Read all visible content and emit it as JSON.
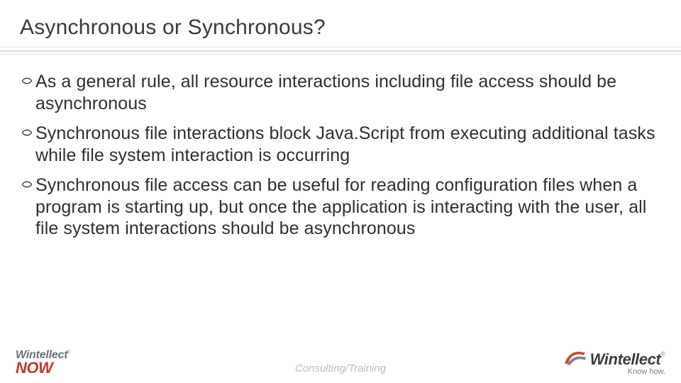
{
  "title": "Asynchronous or Synchronous?",
  "bullets": [
    "As a general rule, all resource interactions including file access should be asynchronous",
    "Synchronous file interactions block Java.Script from executing additional tasks while file system interaction is occurring",
    "Synchronous file access can be useful for reading configuration files when a program is starting up, but once the application is interacting with the user, all file system interactions should be asynchronous"
  ],
  "footer_tag": "Consulting/Training",
  "logo_left": {
    "brand": "Wintellect",
    "reg": "®",
    "sub": "NOW"
  },
  "logo_right": {
    "brand": "Wintellect",
    "reg": "®",
    "tagline": "Know how."
  },
  "colors": {
    "accent_red": "#c0392b",
    "rule": "#d6dde2",
    "text": "#2f2f2f"
  }
}
